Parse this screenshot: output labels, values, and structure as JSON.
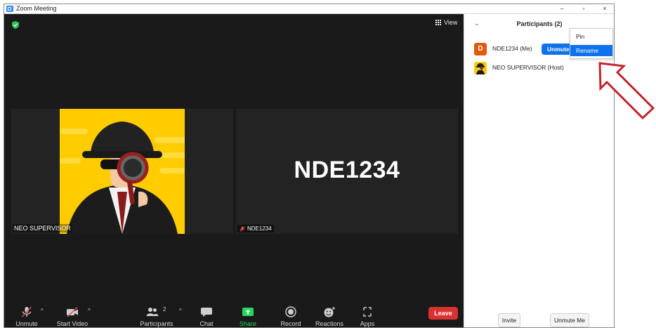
{
  "window": {
    "title": "Zoom Meeting",
    "controls": {
      "minimize": "–",
      "maximize": "▫",
      "close": "×"
    }
  },
  "stage": {
    "view_label": "View",
    "tiles": [
      {
        "name": "NEO SUPERVISOR"
      },
      {
        "name": "NDE1234",
        "big_name": "NDE1234"
      }
    ]
  },
  "toolbar": {
    "unmute": "Unmute",
    "start_video": "Start Video",
    "participants": "Participants",
    "participants_count": "2",
    "chat": "Chat",
    "share_screen": "Share Screen",
    "record": "Record",
    "reactions": "Reactions",
    "apps": "Apps",
    "leave": "Leave"
  },
  "panel": {
    "title": "Participants (2)",
    "participants": [
      {
        "initial": "D",
        "name": "NDE1234 (Me)",
        "action": "Unmute"
      },
      {
        "name": "NEO SUPERVISOR (Host)"
      }
    ],
    "context_menu": [
      "Pin",
      "Rename"
    ],
    "invite": "Invite",
    "unmute_me": "Unmute Me"
  },
  "colors": {
    "accent": "#0e72ed",
    "leave": "#d9322f",
    "share_screen": "#23d959",
    "annotation_arrow": "#c0272d"
  }
}
